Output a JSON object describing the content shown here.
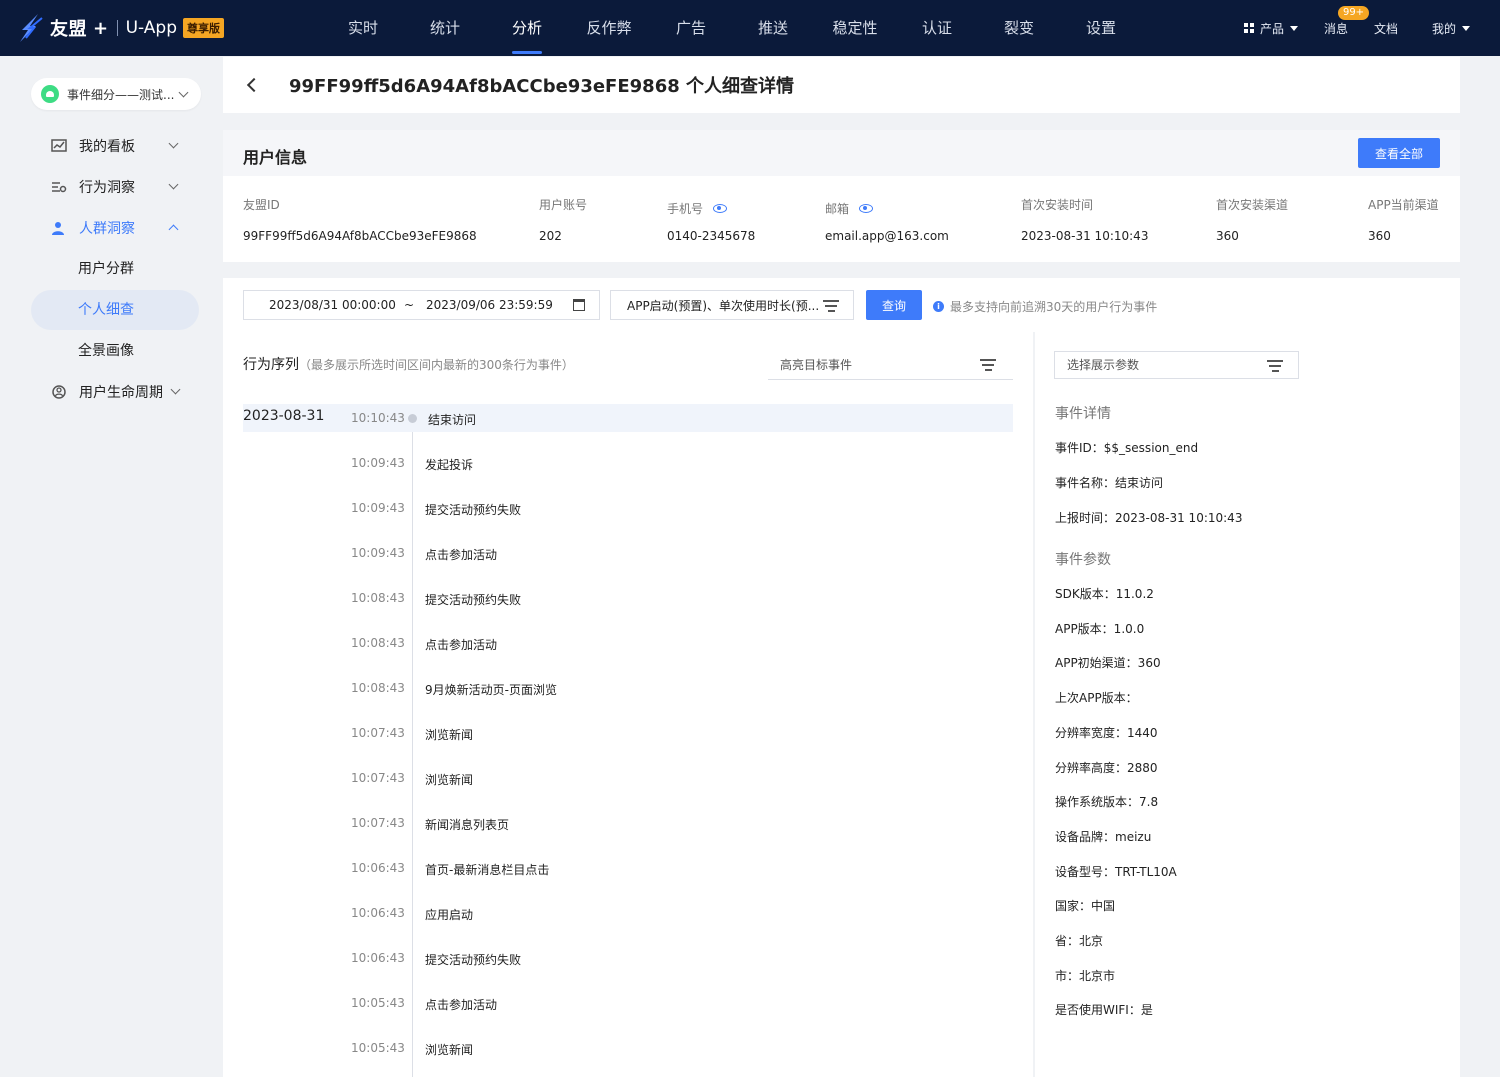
{
  "topnav": {
    "brand": "友盟",
    "brand_plus": "+",
    "app": "U-App",
    "edition_badge": "尊享版",
    "menu": [
      "实时",
      "统计",
      "分析",
      "反作弊",
      "广告",
      "推送",
      "稳定性",
      "认证",
      "裂变",
      "设置"
    ],
    "active_menu": "分析",
    "right": {
      "products": "产品",
      "messages": "消息",
      "message_badge": "99+",
      "docs": "文档",
      "mine": "我的"
    }
  },
  "sidebar": {
    "app_selector": "事件细分——测试...",
    "items": [
      {
        "label": "我的看板",
        "icon": "dashboard-icon"
      },
      {
        "label": "行为洞察",
        "icon": "behavior-icon"
      },
      {
        "label": "人群洞察",
        "icon": "people-icon"
      },
      {
        "label": "用户生命周期",
        "icon": "lifecycle-icon"
      }
    ],
    "sub_items": [
      "用户分群",
      "个人细查",
      "全景画像"
    ],
    "active_sub": "个人细查"
  },
  "header": {
    "title": "99FF99ff5d6A94Af8bACCbe93eFE9868 个人细查详情"
  },
  "user_info": {
    "title": "用户信息",
    "view_all": "查看全部",
    "fields": [
      {
        "label": "友盟ID",
        "value": "99FF99ff5d6A94Af8bACCbe93eFE9868",
        "eye": false
      },
      {
        "label": "用户账号",
        "value": "202",
        "eye": false
      },
      {
        "label": "手机号",
        "value": "0140-2345678",
        "eye": true
      },
      {
        "label": "邮箱",
        "value": "email.app@163.com",
        "eye": true
      },
      {
        "label": "首次安装时间",
        "value": "2023-08-31 10:10:43",
        "eye": false
      },
      {
        "label": "首次安装渠道",
        "value": "360",
        "eye": false
      },
      {
        "label": "APP当前渠道",
        "value": "360",
        "eye": false
      }
    ]
  },
  "filter": {
    "start": "2023/08/31 00:00:00",
    "sep": "~",
    "end": "2023/09/06 23:59:59",
    "events": "APP启动(预置)、单次使用时长(预...",
    "query": "查询",
    "hint": "最多支持向前追溯30天的用户行为事件"
  },
  "timeline": {
    "title": "行为序列",
    "subtitle": "（最多展示所选时间区间内最新的300条行为事件）",
    "highlight_placeholder": "高亮目标事件",
    "date": "2023-08-31",
    "events": [
      {
        "time": "10:10:43",
        "name": "结束访问"
      },
      {
        "time": "10:09:43",
        "name": "发起投诉"
      },
      {
        "time": "10:09:43",
        "name": "提交活动预约失败"
      },
      {
        "time": "10:09:43",
        "name": "点击参加活动"
      },
      {
        "time": "10:08:43",
        "name": "提交活动预约失败"
      },
      {
        "time": "10:08:43",
        "name": "点击参加活动"
      },
      {
        "time": "10:08:43",
        "name": "9月焕新活动页-页面浏览"
      },
      {
        "time": "10:07:43",
        "name": "浏览新闻"
      },
      {
        "time": "10:07:43",
        "name": "浏览新闻"
      },
      {
        "time": "10:07:43",
        "name": "新闻消息列表页"
      },
      {
        "time": "10:06:43",
        "name": "首页-最新消息栏目点击"
      },
      {
        "time": "10:06:43",
        "name": "应用启动"
      },
      {
        "time": "10:06:43",
        "name": "提交活动预约失败"
      },
      {
        "time": "10:05:43",
        "name": "点击参加活动"
      },
      {
        "time": "10:05:43",
        "name": "浏览新闻"
      }
    ]
  },
  "detail": {
    "param_placeholder": "选择展示参数",
    "event_section": "事件详情",
    "event_fields": [
      "事件ID：$$_session_end",
      "事件名称：结束访问",
      "上报时间：2023-08-31 10:10:43"
    ],
    "param_section": "事件参数",
    "param_fields": [
      "SDK版本：11.0.2",
      "APP版本：1.0.0",
      "APP初始渠道：360",
      "上次APP版本：",
      "分辨率宽度：1440",
      "分辨率高度：2880",
      "操作系统版本：7.8",
      "设备品牌：meizu",
      "设备型号：TRT-TL10A",
      "国家：中国",
      "省：北京",
      "市：北京市",
      "是否使用WIFI：是"
    ]
  },
  "colors": {
    "nav_bg": "#0b1a3a",
    "primary": "#3e7bfa",
    "badge": "#f5a623"
  }
}
